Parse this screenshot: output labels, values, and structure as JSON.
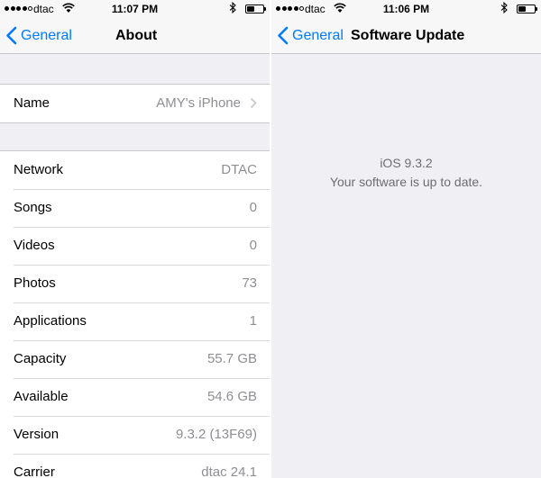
{
  "left": {
    "status": {
      "carrier": "dtac",
      "time": "11:07 PM"
    },
    "nav": {
      "back_label": "General",
      "title": "About"
    },
    "name_row": {
      "label": "Name",
      "value": "AMY's iPhone"
    },
    "rows": [
      {
        "label": "Network",
        "value": "DTAC"
      },
      {
        "label": "Songs",
        "value": "0"
      },
      {
        "label": "Videos",
        "value": "0"
      },
      {
        "label": "Photos",
        "value": "73"
      },
      {
        "label": "Applications",
        "value": "1"
      },
      {
        "label": "Capacity",
        "value": "55.7 GB"
      },
      {
        "label": "Available",
        "value": "54.6 GB"
      },
      {
        "label": "Version",
        "value": "9.3.2 (13F69)"
      },
      {
        "label": "Carrier",
        "value": "dtac 24.1"
      }
    ]
  },
  "right": {
    "status": {
      "carrier": "dtac",
      "time": "11:06 PM"
    },
    "nav": {
      "back_label": "General",
      "title": "Software Update"
    },
    "update": {
      "version": "iOS 9.3.2",
      "message": "Your software is up to date."
    }
  },
  "colors": {
    "accent": "#007aff",
    "background": "#efeff4",
    "secondary_text": "#8e8e93"
  }
}
